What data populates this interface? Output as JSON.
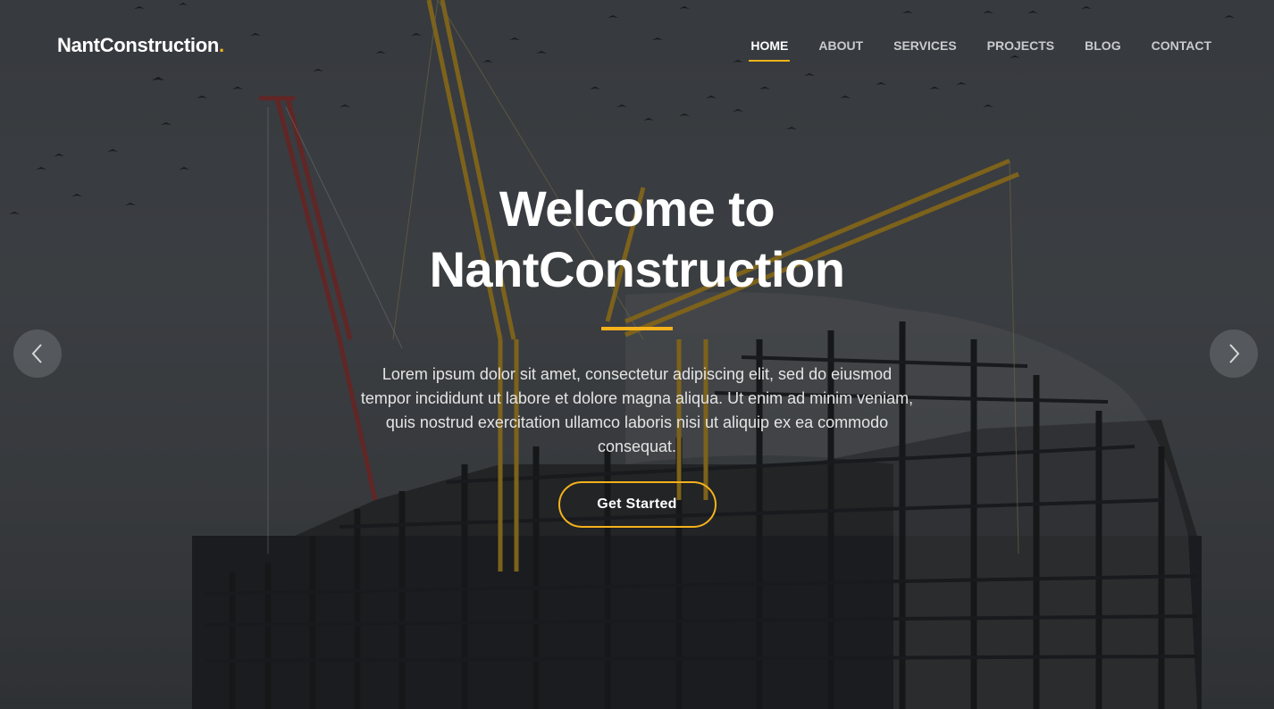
{
  "brand": {
    "name": "NantConstruction",
    "dot": "."
  },
  "nav": {
    "items": [
      {
        "label": "HOME",
        "active": true
      },
      {
        "label": "ABOUT"
      },
      {
        "label": "SERVICES"
      },
      {
        "label": "PROJECTS"
      },
      {
        "label": "BLOG"
      },
      {
        "label": "CONTACT"
      }
    ]
  },
  "hero": {
    "title_line1": "Welcome to",
    "title_line2": "NantConstruction",
    "description": "Lorem ipsum dolor sit amet, consectetur adipiscing elit, sed do eiusmod tempor incididunt ut labore et dolore magna aliqua. Ut enim ad minim veniam, quis nostrud exercitation ullamco laboris nisi ut aliquip ex ea commodo consequat.",
    "cta_label": "Get Started"
  },
  "slider": {
    "prev_icon": "chevron-left-icon",
    "next_icon": "chevron-right-icon"
  },
  "colors": {
    "accent": "#f5b21b",
    "text": "#ffffff"
  }
}
